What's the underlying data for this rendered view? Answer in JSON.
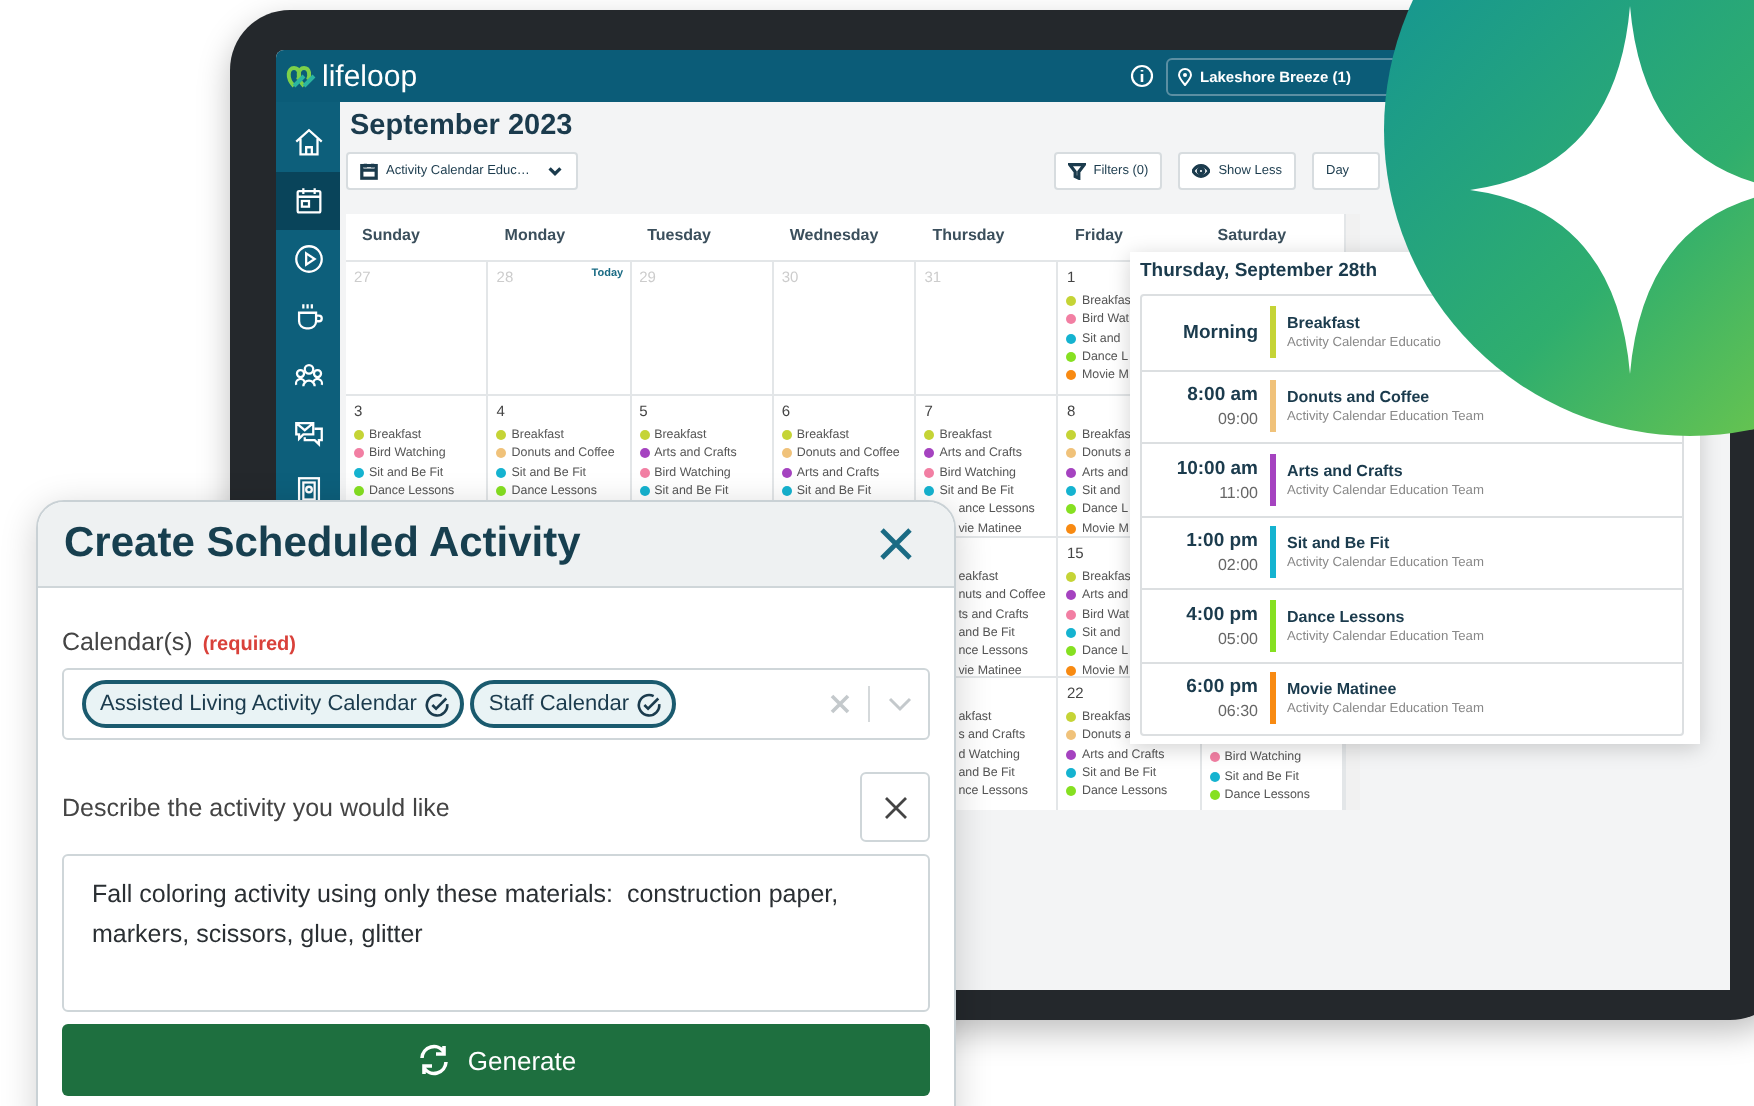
{
  "header": {
    "logo": "lifeloop",
    "location": "Lakeshore Breeze (1)"
  },
  "sidebar": [
    {
      "kind": "home",
      "selected": false
    },
    {
      "kind": "calendar",
      "selected": true
    },
    {
      "kind": "play",
      "selected": false
    },
    {
      "kind": "cup",
      "selected": false
    },
    {
      "kind": "people",
      "selected": false
    },
    {
      "kind": "chat",
      "selected": false
    },
    {
      "kind": "badge",
      "selected": false
    }
  ],
  "title": "September 2023",
  "toolbar": {
    "calendar_select": "Activity Calendar Educ…",
    "filters": "Filters (0)",
    "show_less": "Show Less",
    "view": "Day"
  },
  "calendar": {
    "days": [
      "Sunday",
      "Monday",
      "Tuesday",
      "Wednesday",
      "Thursday",
      "Friday",
      "Saturday"
    ],
    "weeks": [
      {
        "sunday": {
          "day": "27",
          "muted": true
        },
        "monday": {
          "day": "28",
          "muted": true,
          "today_label": "Today"
        },
        "tuesday": {
          "day": "29",
          "muted": true
        },
        "wednesday": {
          "day": "30",
          "muted": true
        },
        "thursday": {
          "day": "31",
          "muted": true
        },
        "friday": {
          "day": "1",
          "muted": false,
          "items": [
            {
              "text": "Breakfas",
              "color": "#c5d436"
            },
            {
              "text": "Bird Wat",
              "color": "#f27fa3"
            },
            {
              "text": "Sit and",
              "color": "#15b3d0"
            },
            {
              "text": "Dance L",
              "color": "#86e021"
            },
            {
              "text": "Movie M",
              "color": "#f88a12"
            }
          ]
        }
      },
      {
        "sunday": {
          "day": "3",
          "muted": false,
          "items": [
            {
              "text": "Breakfast",
              "color": "#c5d436"
            },
            {
              "text": "Bird Watching",
              "color": "#f27fa3"
            },
            {
              "text": "Sit and Be Fit",
              "color": "#15b3d0"
            },
            {
              "text": "Dance Lessons",
              "color": "#86e021"
            }
          ]
        },
        "monday": {
          "day": "4",
          "muted": false,
          "items": [
            {
              "text": "Breakfast",
              "color": "#c5d436"
            },
            {
              "text": "Donuts and Coffee",
              "color": "#f0c27a"
            },
            {
              "text": "Sit and Be Fit",
              "color": "#15b3d0"
            },
            {
              "text": "Dance Lessons",
              "color": "#86e021"
            }
          ]
        },
        "tuesday": {
          "day": "5",
          "muted": false,
          "items": [
            {
              "text": "Breakfast",
              "color": "#c5d436"
            },
            {
              "text": "Arts and Crafts",
              "color": "#a543c0"
            },
            {
              "text": "Bird Watching",
              "color": "#f27fa3"
            },
            {
              "text": "Sit and Be Fit",
              "color": "#15b3d0"
            }
          ]
        },
        "wednesday": {
          "day": "6",
          "muted": false,
          "items": [
            {
              "text": "Breakfast",
              "color": "#c5d436"
            },
            {
              "text": "Donuts and Coffee",
              "color": "#f0c27a"
            },
            {
              "text": "Arts and Crafts",
              "color": "#a543c0"
            },
            {
              "text": "Sit and Be Fit",
              "color": "#15b3d0"
            }
          ]
        },
        "thursday": {
          "day": "7",
          "muted": false,
          "items": [
            {
              "text": "Breakfast",
              "color": "#c5d436"
            },
            {
              "text": "Arts and Crafts",
              "color": "#a543c0"
            },
            {
              "text": "Bird Watching",
              "color": "#f27fa3"
            },
            {
              "text": "Sit and Be Fit",
              "color": "#15b3d0"
            },
            {
              "text": "ance Lessons"
            },
            {
              "text": "vie Matinee"
            }
          ]
        },
        "friday": {
          "day": "8",
          "muted": false,
          "items": [
            {
              "text": "Breakfas",
              "color": "#c5d436"
            },
            {
              "text": "Donuts a",
              "color": "#f0c27a"
            },
            {
              "text": "Arts and",
              "color": "#a543c0"
            },
            {
              "text": "Sit and",
              "color": "#15b3d0"
            },
            {
              "text": "Dance L",
              "color": "#86e021"
            },
            {
              "text": "Movie M",
              "color": "#f88a12"
            }
          ]
        }
      },
      {
        "thursday": {
          "items": [
            {
              "text": "eakfast"
            },
            {
              "text": "nuts and Coffee"
            },
            {
              "text": "ts and Crafts"
            },
            {
              "text": "and Be Fit"
            },
            {
              "text": "nce Lessons"
            },
            {
              "text": "vie Matinee"
            }
          ]
        },
        "friday": {
          "day": "15",
          "muted": false,
          "items": [
            {
              "text": "Breakfas",
              "color": "#c5d436"
            },
            {
              "text": "Arts and",
              "color": "#a543c0"
            },
            {
              "text": "Bird Wat",
              "color": "#f27fa3"
            },
            {
              "text": "Sit and",
              "color": "#15b3d0"
            },
            {
              "text": "Dance L",
              "color": "#86e021"
            },
            {
              "text": "Movie M",
              "color": "#f88a12"
            }
          ]
        }
      },
      {
        "thursday": {
          "items": [
            {
              "text": "akfast"
            },
            {
              "text": "s and Crafts"
            },
            {
              "text": "d Watching"
            },
            {
              "text": "and Be Fit"
            },
            {
              "text": "nce Lessons"
            }
          ]
        },
        "friday": {
          "day": "22",
          "muted": false,
          "items": [
            {
              "text": "Breakfas",
              "color": "#c5d436"
            },
            {
              "text": "Donuts a",
              "color": "#f0c27a"
            },
            {
              "text": "Arts and Crafts",
              "color": "#a543c0"
            },
            {
              "text": "Sit and Be Fit",
              "color": "#15b3d0"
            },
            {
              "text": "Dance Lessons",
              "color": "#86e021"
            }
          ]
        },
        "saturday": {
          "covered": true,
          "items": [
            {
              "text": "Bird Watching",
              "color": "#f27fa3"
            },
            {
              "text": "Sit and Be Fit",
              "color": "#15b3d0"
            },
            {
              "text": "Dance Lessons",
              "color": "#86e021"
            }
          ]
        }
      }
    ]
  },
  "day_panel": {
    "title": "Thursday, September 28th",
    "events": [
      {
        "time": "Morning",
        "title": "Breakfast",
        "team": "Activity Calendar Educatio",
        "color": "#c5d436"
      },
      {
        "time": "8:00 am",
        "end": "09:00",
        "title": "Donuts and Coffee",
        "team": "Activity Calendar Education Team",
        "color": "#f0c27a"
      },
      {
        "time": "10:00 am",
        "end": "11:00",
        "title": "Arts and Crafts",
        "team": "Activity Calendar Education Team",
        "color": "#a543c0"
      },
      {
        "time": "1:00 pm",
        "end": "02:00",
        "title": "Sit and Be Fit",
        "team": "Activity Calendar Education Team",
        "color": "#15b3d0"
      },
      {
        "time": "4:00 pm",
        "end": "05:00",
        "title": "Dance Lessons",
        "team": "Activity Calendar Education Team",
        "color": "#86e021"
      },
      {
        "time": "6:00 pm",
        "end": "06:30",
        "title": "Movie Matinee",
        "team": "Activity Calendar Education Team",
        "color": "#f88a12"
      }
    ]
  },
  "dialog": {
    "title": "Create Scheduled Activity",
    "calendar_label": "Calendar(s)",
    "required": "(required)",
    "calendars": [
      "Assisted Living Activity Calendar",
      "Staff Calendar"
    ],
    "description_label": "Describe the activity you would like",
    "description": "Fall coloring activity using only these materials:  construction paper, markers, scissors, glue, glitter",
    "generate": "Generate"
  }
}
